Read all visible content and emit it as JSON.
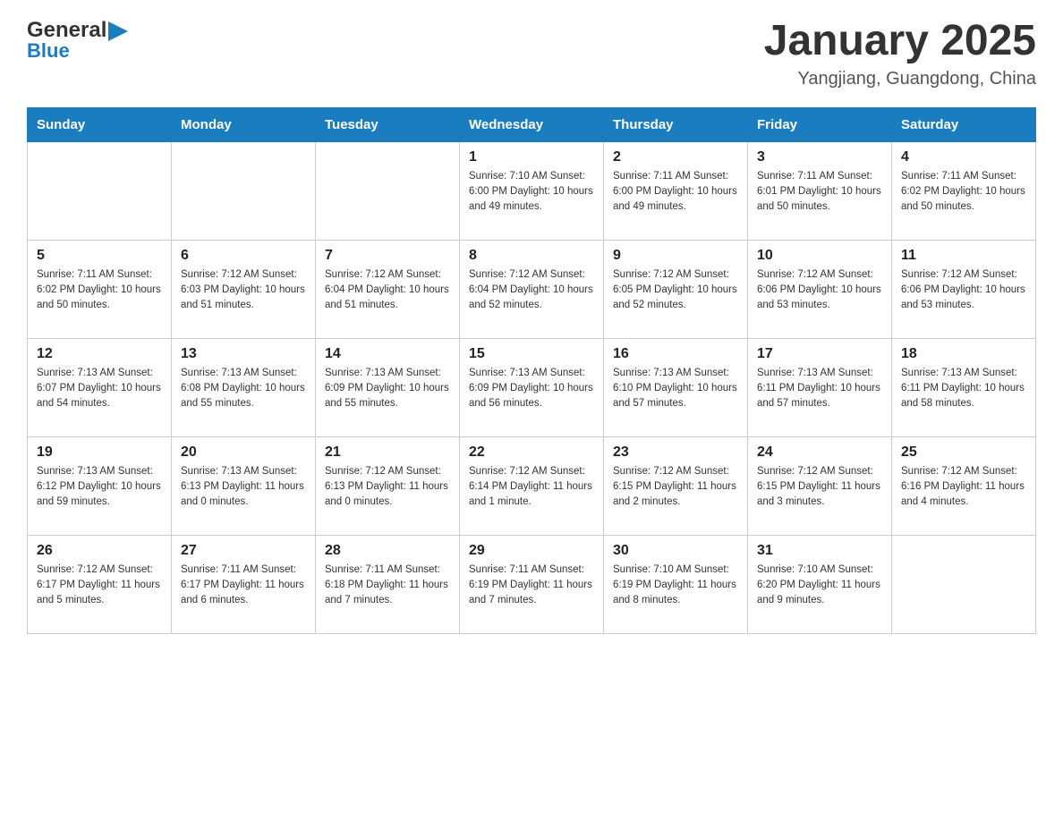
{
  "header": {
    "logo": {
      "general": "General",
      "blue": "Blue"
    },
    "title": "January 2025",
    "location": "Yangjiang, Guangdong, China"
  },
  "calendar": {
    "days_of_week": [
      "Sunday",
      "Monday",
      "Tuesday",
      "Wednesday",
      "Thursday",
      "Friday",
      "Saturday"
    ],
    "weeks": [
      [
        {
          "day": "",
          "info": ""
        },
        {
          "day": "",
          "info": ""
        },
        {
          "day": "",
          "info": ""
        },
        {
          "day": "1",
          "info": "Sunrise: 7:10 AM\nSunset: 6:00 PM\nDaylight: 10 hours\nand 49 minutes."
        },
        {
          "day": "2",
          "info": "Sunrise: 7:11 AM\nSunset: 6:00 PM\nDaylight: 10 hours\nand 49 minutes."
        },
        {
          "day": "3",
          "info": "Sunrise: 7:11 AM\nSunset: 6:01 PM\nDaylight: 10 hours\nand 50 minutes."
        },
        {
          "day": "4",
          "info": "Sunrise: 7:11 AM\nSunset: 6:02 PM\nDaylight: 10 hours\nand 50 minutes."
        }
      ],
      [
        {
          "day": "5",
          "info": "Sunrise: 7:11 AM\nSunset: 6:02 PM\nDaylight: 10 hours\nand 50 minutes."
        },
        {
          "day": "6",
          "info": "Sunrise: 7:12 AM\nSunset: 6:03 PM\nDaylight: 10 hours\nand 51 minutes."
        },
        {
          "day": "7",
          "info": "Sunrise: 7:12 AM\nSunset: 6:04 PM\nDaylight: 10 hours\nand 51 minutes."
        },
        {
          "day": "8",
          "info": "Sunrise: 7:12 AM\nSunset: 6:04 PM\nDaylight: 10 hours\nand 52 minutes."
        },
        {
          "day": "9",
          "info": "Sunrise: 7:12 AM\nSunset: 6:05 PM\nDaylight: 10 hours\nand 52 minutes."
        },
        {
          "day": "10",
          "info": "Sunrise: 7:12 AM\nSunset: 6:06 PM\nDaylight: 10 hours\nand 53 minutes."
        },
        {
          "day": "11",
          "info": "Sunrise: 7:12 AM\nSunset: 6:06 PM\nDaylight: 10 hours\nand 53 minutes."
        }
      ],
      [
        {
          "day": "12",
          "info": "Sunrise: 7:13 AM\nSunset: 6:07 PM\nDaylight: 10 hours\nand 54 minutes."
        },
        {
          "day": "13",
          "info": "Sunrise: 7:13 AM\nSunset: 6:08 PM\nDaylight: 10 hours\nand 55 minutes."
        },
        {
          "day": "14",
          "info": "Sunrise: 7:13 AM\nSunset: 6:09 PM\nDaylight: 10 hours\nand 55 minutes."
        },
        {
          "day": "15",
          "info": "Sunrise: 7:13 AM\nSunset: 6:09 PM\nDaylight: 10 hours\nand 56 minutes."
        },
        {
          "day": "16",
          "info": "Sunrise: 7:13 AM\nSunset: 6:10 PM\nDaylight: 10 hours\nand 57 minutes."
        },
        {
          "day": "17",
          "info": "Sunrise: 7:13 AM\nSunset: 6:11 PM\nDaylight: 10 hours\nand 57 minutes."
        },
        {
          "day": "18",
          "info": "Sunrise: 7:13 AM\nSunset: 6:11 PM\nDaylight: 10 hours\nand 58 minutes."
        }
      ],
      [
        {
          "day": "19",
          "info": "Sunrise: 7:13 AM\nSunset: 6:12 PM\nDaylight: 10 hours\nand 59 minutes."
        },
        {
          "day": "20",
          "info": "Sunrise: 7:13 AM\nSunset: 6:13 PM\nDaylight: 11 hours\nand 0 minutes."
        },
        {
          "day": "21",
          "info": "Sunrise: 7:12 AM\nSunset: 6:13 PM\nDaylight: 11 hours\nand 0 minutes."
        },
        {
          "day": "22",
          "info": "Sunrise: 7:12 AM\nSunset: 6:14 PM\nDaylight: 11 hours\nand 1 minute."
        },
        {
          "day": "23",
          "info": "Sunrise: 7:12 AM\nSunset: 6:15 PM\nDaylight: 11 hours\nand 2 minutes."
        },
        {
          "day": "24",
          "info": "Sunrise: 7:12 AM\nSunset: 6:15 PM\nDaylight: 11 hours\nand 3 minutes."
        },
        {
          "day": "25",
          "info": "Sunrise: 7:12 AM\nSunset: 6:16 PM\nDaylight: 11 hours\nand 4 minutes."
        }
      ],
      [
        {
          "day": "26",
          "info": "Sunrise: 7:12 AM\nSunset: 6:17 PM\nDaylight: 11 hours\nand 5 minutes."
        },
        {
          "day": "27",
          "info": "Sunrise: 7:11 AM\nSunset: 6:17 PM\nDaylight: 11 hours\nand 6 minutes."
        },
        {
          "day": "28",
          "info": "Sunrise: 7:11 AM\nSunset: 6:18 PM\nDaylight: 11 hours\nand 7 minutes."
        },
        {
          "day": "29",
          "info": "Sunrise: 7:11 AM\nSunset: 6:19 PM\nDaylight: 11 hours\nand 7 minutes."
        },
        {
          "day": "30",
          "info": "Sunrise: 7:10 AM\nSunset: 6:19 PM\nDaylight: 11 hours\nand 8 minutes."
        },
        {
          "day": "31",
          "info": "Sunrise: 7:10 AM\nSunset: 6:20 PM\nDaylight: 11 hours\nand 9 minutes."
        },
        {
          "day": "",
          "info": ""
        }
      ]
    ]
  }
}
